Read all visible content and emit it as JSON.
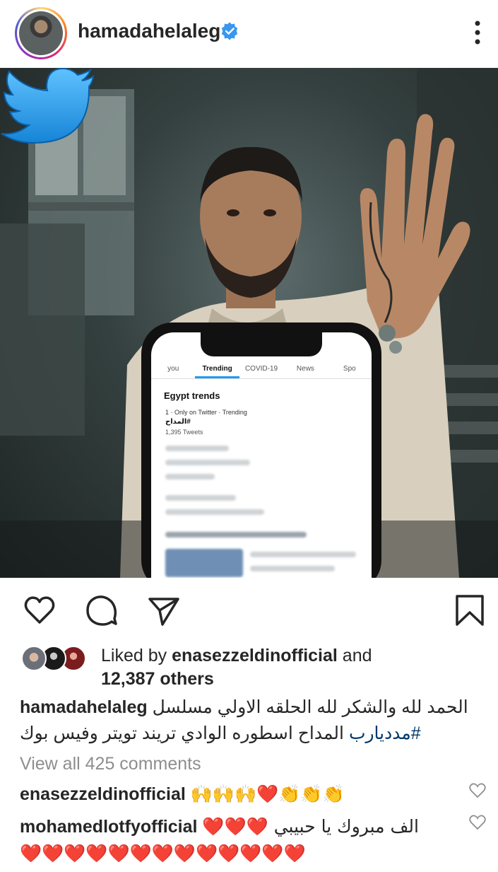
{
  "header": {
    "username": "hamadahelaleg",
    "verified_icon": "verified-badge-icon",
    "more_icon": "more-options-icon"
  },
  "post_image": {
    "phone": {
      "tabs": [
        "you",
        "Trending",
        "COVID-19",
        "News",
        "Spo"
      ],
      "active_tab": "Trending",
      "trends_title": "Egypt trends",
      "trend_meta": "1 · Only on Twitter · Trending",
      "trend_tag": "#المداح",
      "trend_count": "1,395 Tweets"
    }
  },
  "actions": {
    "like_icon": "heart-icon",
    "comment_icon": "comment-icon",
    "share_icon": "send-icon",
    "save_icon": "bookmark-icon"
  },
  "likes": {
    "prefix": "Liked by ",
    "user": "enasezzeldinofficial",
    "and": " and",
    "others": "12,387 others"
  },
  "caption": {
    "user": "hamadahelaleg",
    "line1": "الحمد لله والشكر لله الحلقه الاولي مسلسل",
    "line2": "المداح اسطوره الوادي تريند تويتر وفيس بوك",
    "hashtag": "#مدديارب"
  },
  "view_all": "View all 425 comments",
  "comments": [
    {
      "user": "enasezzeldinofficial",
      "text": "🙌🙌🙌❤️👏👏👏"
    },
    {
      "user": "mohamedlotfyofficial",
      "text": "الف مبروك يا حبيبي ❤️❤️❤️",
      "text2": "❤️❤️❤️❤️❤️❤️❤️❤️❤️❤️❤️❤️❤️"
    }
  ],
  "colors": {
    "accent_blue": "#3897f0",
    "hashtag": "#00376b",
    "muted": "#8e8e8e"
  }
}
